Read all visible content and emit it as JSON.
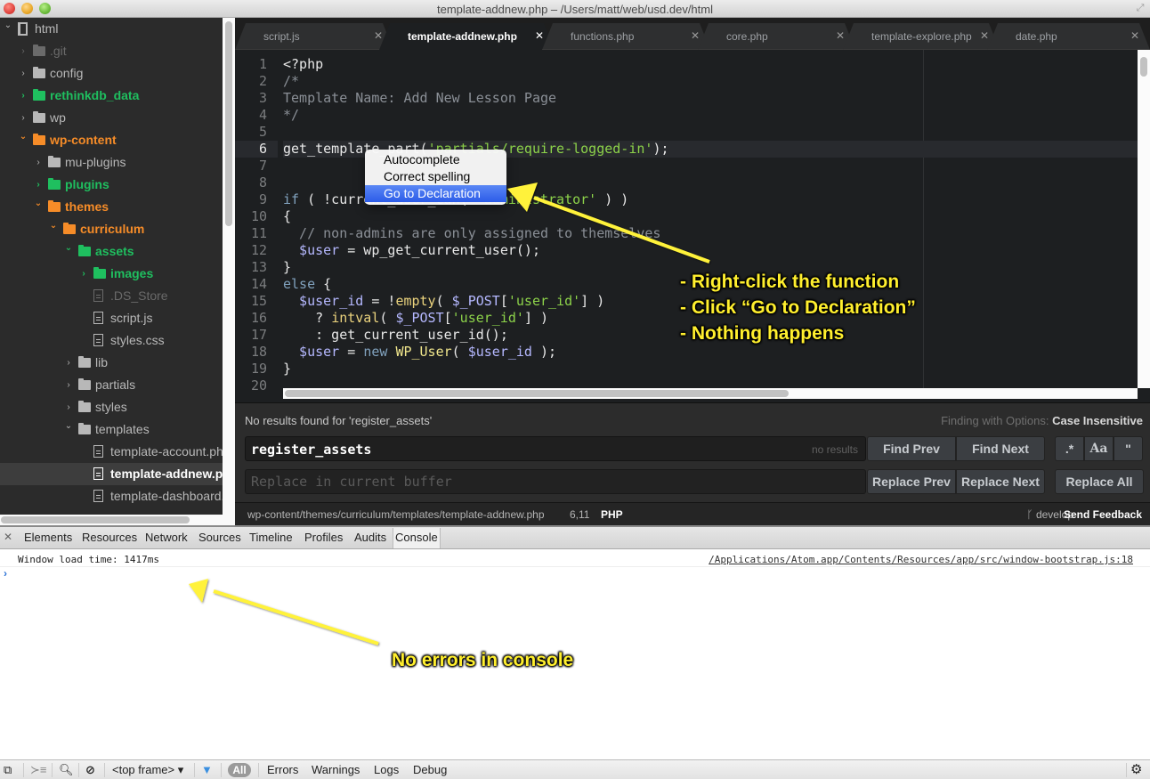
{
  "window": {
    "title": "template-addnew.php – /Users/matt/web/usd.dev/html"
  },
  "tree": {
    "items": [
      {
        "label": "html",
        "depth": 0,
        "type": "repo",
        "expanded": true,
        "status": "normal"
      },
      {
        "label": ".git",
        "depth": 1,
        "type": "folder",
        "expanded": false,
        "status": "ignored"
      },
      {
        "label": "config",
        "depth": 1,
        "type": "folder",
        "expanded": false,
        "status": "normal"
      },
      {
        "label": "rethinkdb_data",
        "depth": 1,
        "type": "folder",
        "expanded": false,
        "status": "added"
      },
      {
        "label": "wp",
        "depth": 1,
        "type": "folder",
        "expanded": false,
        "status": "normal"
      },
      {
        "label": "wp-content",
        "depth": 1,
        "type": "folder",
        "expanded": true,
        "status": "modified"
      },
      {
        "label": "mu-plugins",
        "depth": 2,
        "type": "folder",
        "expanded": false,
        "status": "normal"
      },
      {
        "label": "plugins",
        "depth": 2,
        "type": "folder",
        "expanded": false,
        "status": "added"
      },
      {
        "label": "themes",
        "depth": 2,
        "type": "folder",
        "expanded": true,
        "status": "modified"
      },
      {
        "label": "curriculum",
        "depth": 3,
        "type": "folder",
        "expanded": true,
        "status": "modified"
      },
      {
        "label": "assets",
        "depth": 4,
        "type": "folder",
        "expanded": true,
        "status": "added"
      },
      {
        "label": "images",
        "depth": 5,
        "type": "folder",
        "expanded": false,
        "status": "added"
      },
      {
        "label": ".DS_Store",
        "depth": 5,
        "type": "file",
        "status": "ignored"
      },
      {
        "label": "script.js",
        "depth": 5,
        "type": "file",
        "status": "normal"
      },
      {
        "label": "styles.css",
        "depth": 5,
        "type": "file",
        "status": "normal"
      },
      {
        "label": "lib",
        "depth": 4,
        "type": "folder",
        "expanded": false,
        "status": "normal"
      },
      {
        "label": "partials",
        "depth": 4,
        "type": "folder",
        "expanded": false,
        "status": "normal"
      },
      {
        "label": "styles",
        "depth": 4,
        "type": "folder",
        "expanded": false,
        "status": "normal"
      },
      {
        "label": "templates",
        "depth": 4,
        "type": "folder",
        "expanded": true,
        "status": "normal"
      },
      {
        "label": "template-account.php",
        "depth": 5,
        "type": "file",
        "status": "normal"
      },
      {
        "label": "template-addnew.php",
        "depth": 5,
        "type": "file",
        "status": "selected"
      },
      {
        "label": "template-dashboard.php",
        "depth": 5,
        "type": "file",
        "status": "normal"
      }
    ]
  },
  "tabs": [
    {
      "label": "script.js",
      "active": false
    },
    {
      "label": "template-addnew.php",
      "active": true
    },
    {
      "label": "functions.php",
      "active": false
    },
    {
      "label": "core.php",
      "active": false
    },
    {
      "label": "template-explore.php",
      "active": false
    },
    {
      "label": "date.php",
      "active": false
    }
  ],
  "editor": {
    "current_line": 6,
    "lines": [
      [
        [
          "t",
          "<?php"
        ]
      ],
      [
        [
          "cm",
          "/*"
        ]
      ],
      [
        [
          "cm",
          "Template Name: Add New Lesson Page"
        ]
      ],
      [
        [
          "cm",
          "*/"
        ]
      ],
      [],
      [
        [
          "t",
          "get_template_part("
        ],
        [
          "str",
          "'partials/require-logged-in'"
        ],
        [
          "t",
          ");"
        ]
      ],
      [],
      [],
      [
        [
          "kw",
          "if"
        ],
        [
          "t",
          " ( !current_user_can( "
        ],
        [
          "str",
          "'administrator'"
        ],
        [
          "t",
          " ) )"
        ]
      ],
      [
        [
          "t",
          "{"
        ]
      ],
      [
        [
          "cm",
          "  // non-admins are only assigned to themselves"
        ]
      ],
      [
        [
          "var",
          "  $user"
        ],
        [
          "t",
          " = wp_get_current_user();"
        ]
      ],
      [
        [
          "t",
          "}"
        ]
      ],
      [
        [
          "kw",
          "else"
        ],
        [
          "t",
          " {"
        ]
      ],
      [
        [
          "var",
          "  $user_id"
        ],
        [
          "t",
          " = !"
        ],
        [
          "fn",
          "empty"
        ],
        [
          "t",
          "( "
        ],
        [
          "var",
          "$_POST"
        ],
        [
          "t",
          "["
        ],
        [
          "str",
          "'user_id'"
        ],
        [
          "t",
          "] )"
        ]
      ],
      [
        [
          "t",
          "    ? "
        ],
        [
          "fn",
          "intval"
        ],
        [
          "t",
          "( "
        ],
        [
          "var",
          "$_POST"
        ],
        [
          "t",
          "["
        ],
        [
          "str",
          "'user_id'"
        ],
        [
          "t",
          "] )"
        ]
      ],
      [
        [
          "t",
          "    : get_current_user_id();"
        ]
      ],
      [
        [
          "var",
          "  $user"
        ],
        [
          "t",
          " = "
        ],
        [
          "kw",
          "new"
        ],
        [
          "t",
          " "
        ],
        [
          "cls",
          "WP_User"
        ],
        [
          "t",
          "( "
        ],
        [
          "var",
          "$user_id"
        ],
        [
          "t",
          " );"
        ]
      ],
      [
        [
          "t",
          "}"
        ]
      ],
      []
    ]
  },
  "context_menu": {
    "items": [
      {
        "label": "Autocomplete",
        "highlighted": false
      },
      {
        "label": "Correct spelling",
        "highlighted": false
      },
      {
        "label": "Go to Declaration",
        "highlighted": true
      }
    ]
  },
  "find": {
    "message": "No results found for 'register_assets'",
    "options_prefix": "Finding with Options:",
    "options_value": "Case Insensitive",
    "query": "register_assets",
    "result_count": "no results",
    "replace_placeholder": "Replace in current buffer",
    "buttons": {
      "find_prev": "Find Prev",
      "find_next": "Find Next",
      "regex": ".*",
      "case": "Aa",
      "whole": "\"",
      "replace_prev": "Replace Prev",
      "replace_next": "Replace Next",
      "replace_all": "Replace All"
    }
  },
  "status_bar": {
    "path": "wp-content/themes/curriculum/templates/template-addnew.php",
    "cursor": "6,11",
    "grammar": "PHP",
    "branch": "develop",
    "feedback": "Send Feedback"
  },
  "devtools": {
    "tabs": [
      "Elements",
      "Resources",
      "Network",
      "Sources",
      "Timeline",
      "Profiles",
      "Audits",
      "Console"
    ],
    "active_tab": "Console",
    "messages": [
      {
        "text": "Window load time: 1417ms",
        "source": "/Applications/Atom.app/Contents/Resources/app/src/window-bootstrap.js:18"
      }
    ],
    "prompt": "›",
    "bottom": {
      "frame": "<top frame>",
      "filters": [
        "All",
        "Errors",
        "Warnings",
        "Logs",
        "Debug"
      ],
      "active_filter": "All"
    }
  },
  "annotations": {
    "steps": [
      "- Right-click the function",
      "- Click “Go to Declaration”",
      "- Nothing happens"
    ],
    "console_note": "No errors in console",
    "color": "#ffef2e"
  }
}
